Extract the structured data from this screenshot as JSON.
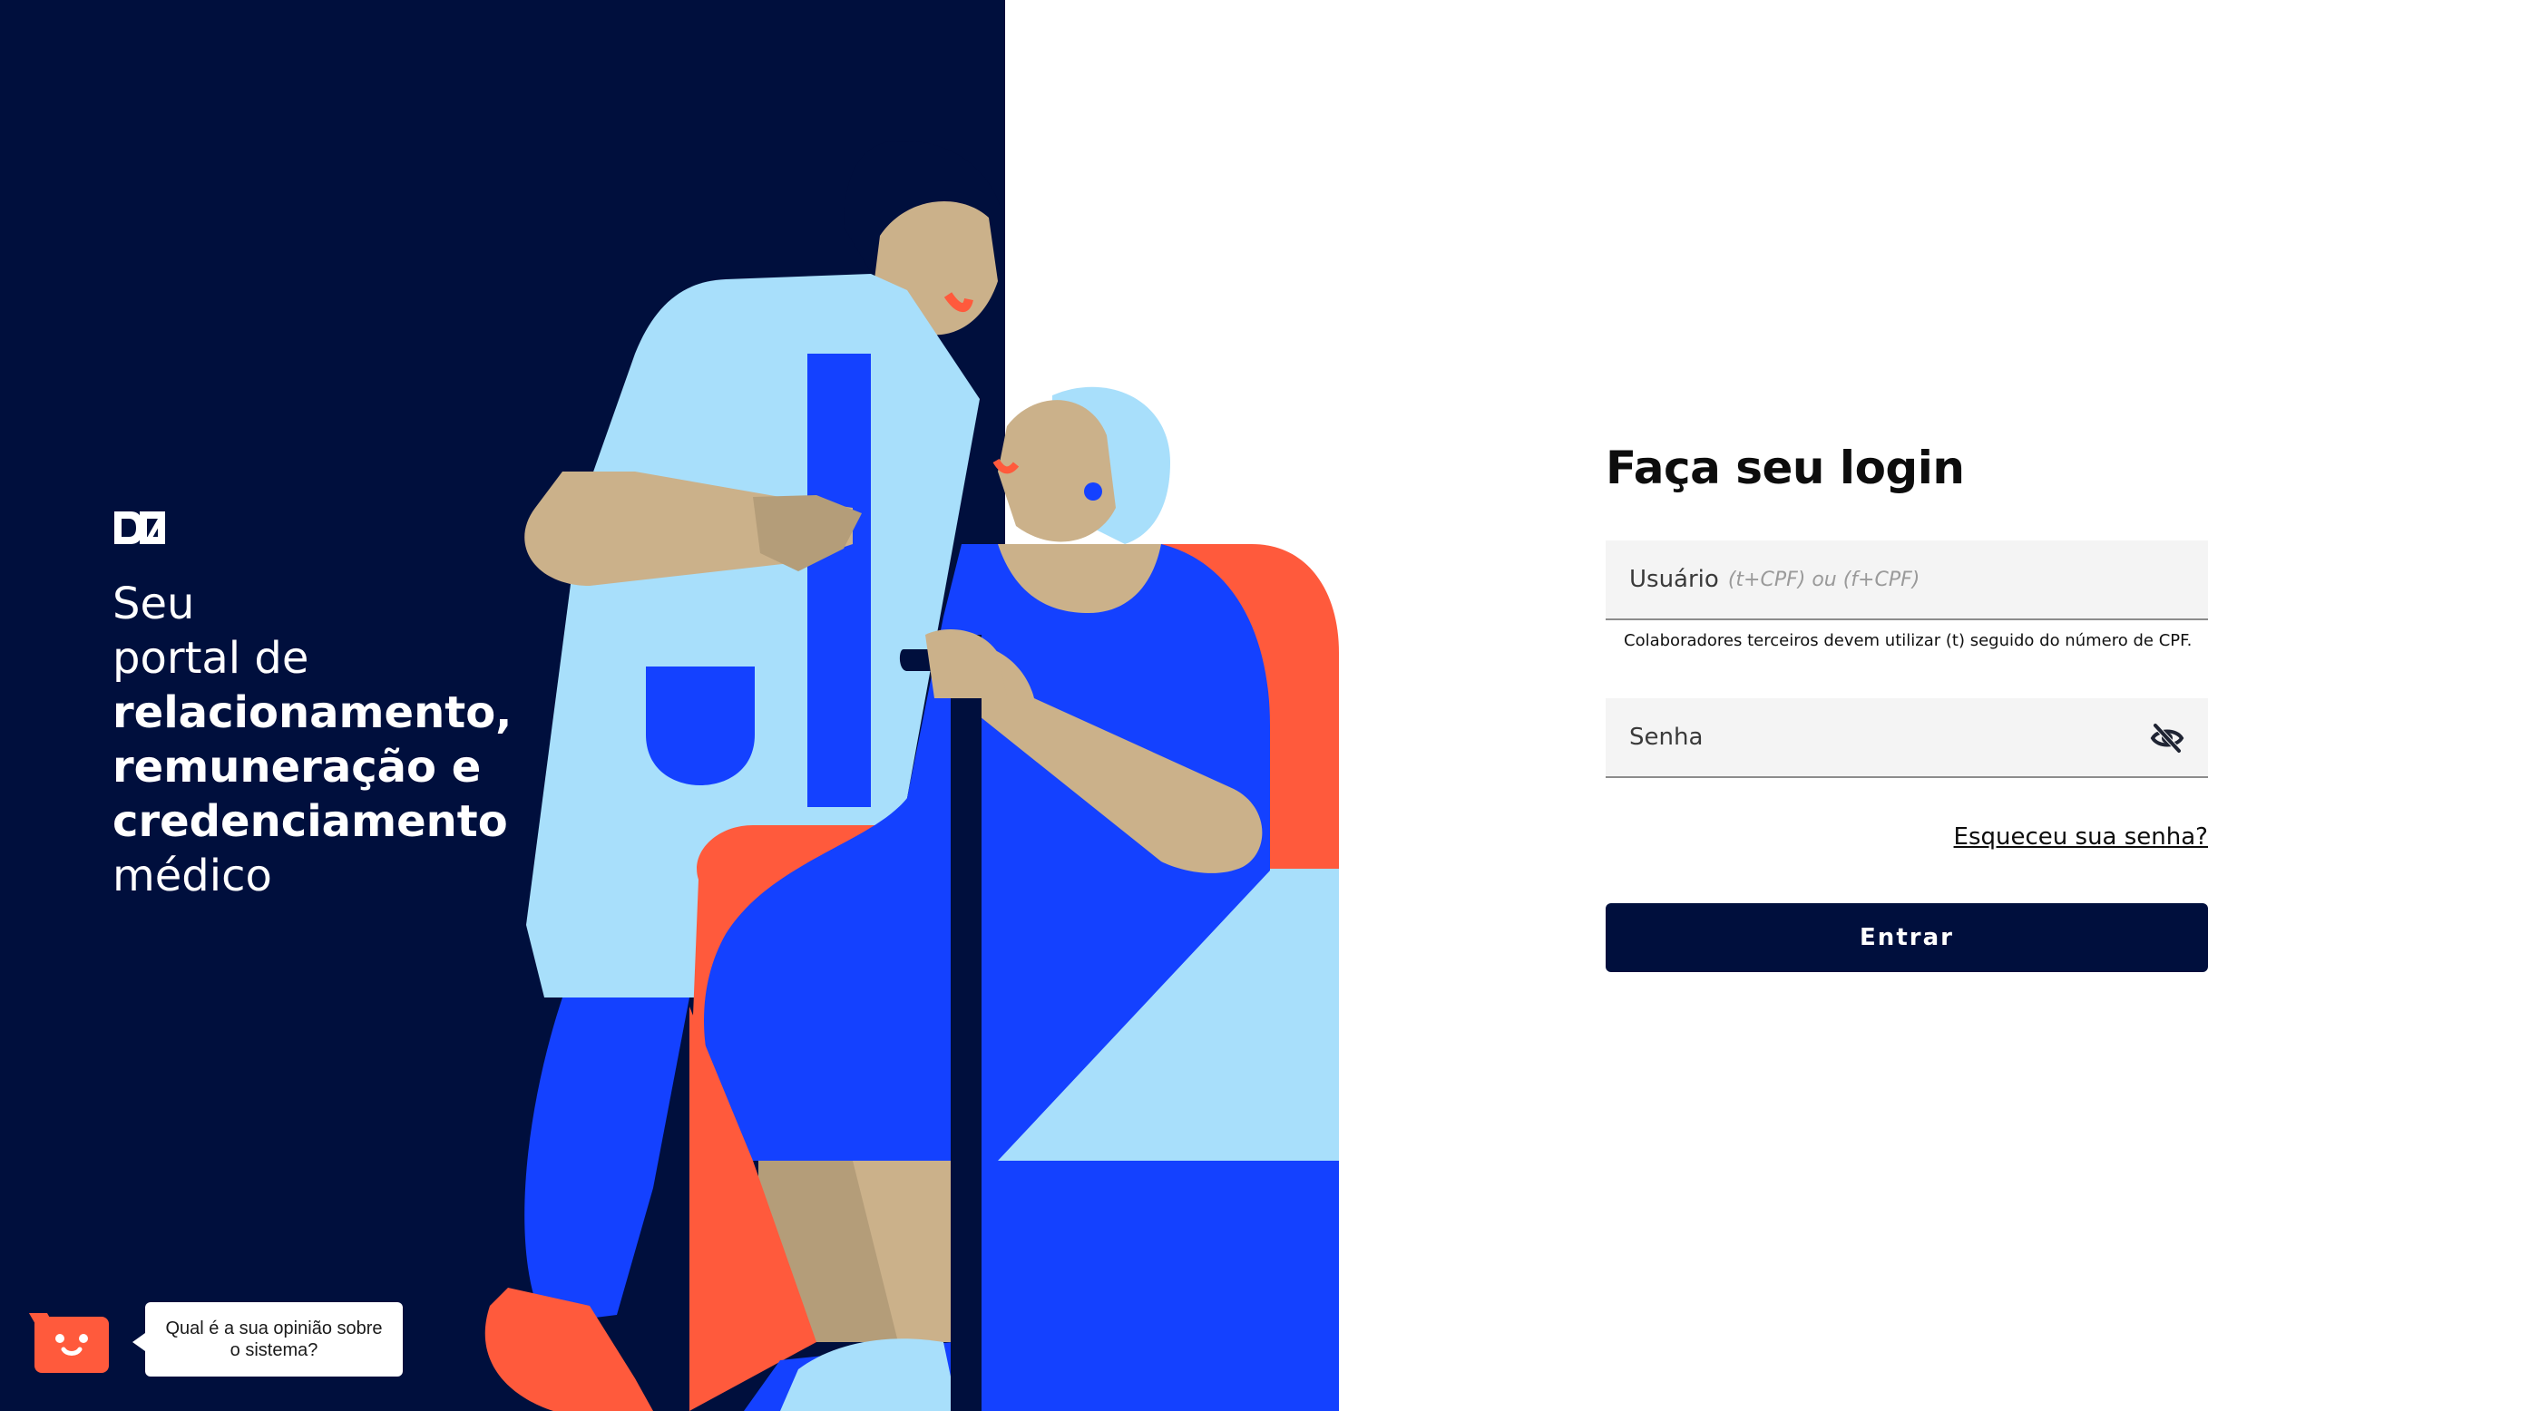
{
  "hero": {
    "tagline_lines": [
      "Seu",
      "portal de",
      "relacionamento,",
      "remuneração e",
      "credenciamento",
      "médico"
    ],
    "logo_icon": "brand-logo-icon"
  },
  "login": {
    "title": "Faça seu login",
    "user_label": "Usuário",
    "user_hint": "(t+CPF) ou (f+CPF)",
    "helper_text": "Colaboradores terceiros devem utilizar (t) seguido do número de CPF.",
    "password_label": "Senha",
    "password_toggle_icon": "eye-off-icon",
    "forgot_link": "Esqueceu sua senha?",
    "submit_label": "Entrar"
  },
  "feedback": {
    "icon": "smiley-chat-icon",
    "prompt": "Qual é a sua opinião sobre o sistema?"
  },
  "colors": {
    "navy": "#000f3d",
    "blue": "#1441ff",
    "light_blue": "#a8dffb",
    "coral": "#ff5a3c",
    "skin": "#cbb18a"
  }
}
